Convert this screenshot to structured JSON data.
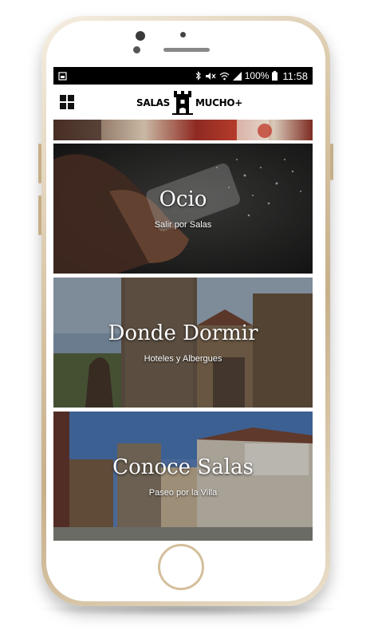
{
  "status_bar": {
    "battery_percent": "100%",
    "time": "11:58",
    "icons": [
      "sim-icon",
      "bluetooth-icon",
      "mute-icon",
      "wifi-icon",
      "signal-icon",
      "battery-icon"
    ]
  },
  "header": {
    "logo_left": "SALAS",
    "logo_right": "MUCHO+",
    "logo_icon": "castle-tower-icon",
    "menu_icon": "grid-menu-icon"
  },
  "cards": [
    {
      "title": "Ocio",
      "subtitle": "Salir por Salas"
    },
    {
      "title": "Donde Dormir",
      "subtitle": "Hoteles y Albergues"
    },
    {
      "title": "Conoce Salas",
      "subtitle": "Paseo por la Villa"
    }
  ],
  "colors": {
    "frame_gold": "#d9c7a8",
    "status_bar": "#000000",
    "text_on_image": "#ffffff"
  }
}
